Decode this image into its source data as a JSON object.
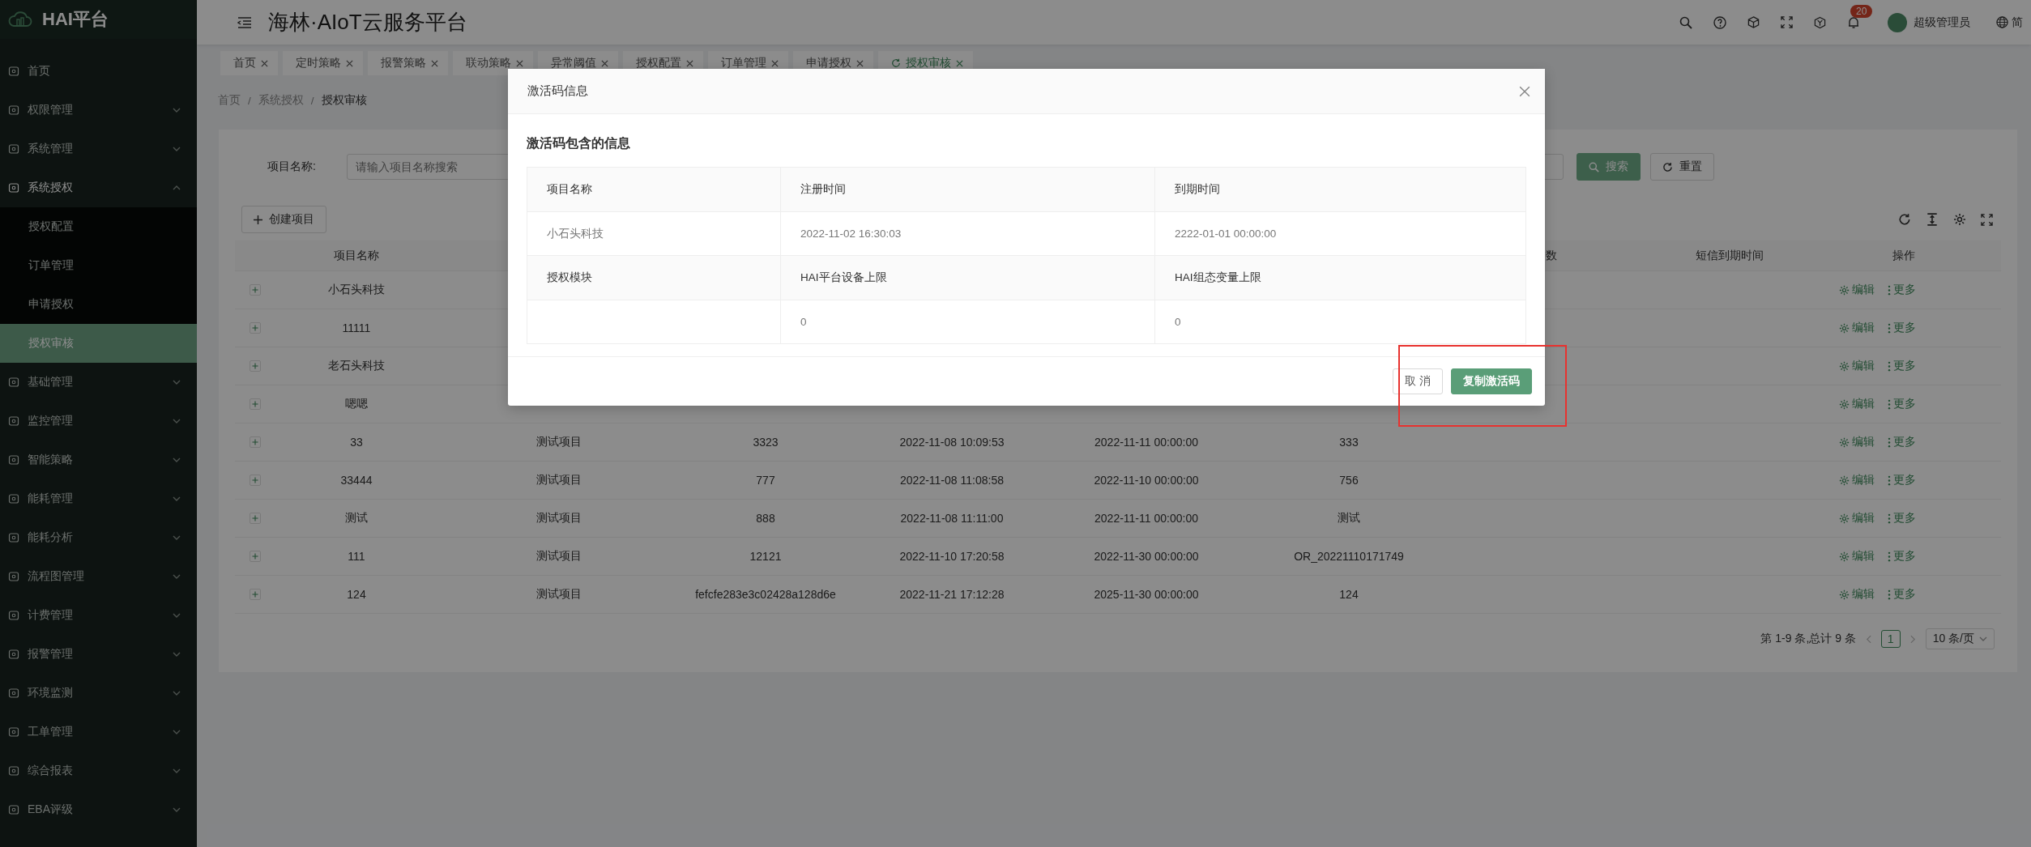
{
  "brand": {
    "name": "HAI平台"
  },
  "sidebar": {
    "items": [
      {
        "label": "首页",
        "kind": "link"
      },
      {
        "label": "权限管理",
        "kind": "group",
        "expanded": false
      },
      {
        "label": "系统管理",
        "kind": "group",
        "expanded": false
      },
      {
        "label": "系统授权",
        "kind": "group",
        "expanded": true,
        "children": [
          {
            "label": "授权配置",
            "selected": false
          },
          {
            "label": "订单管理",
            "selected": false
          },
          {
            "label": "申请授权",
            "selected": false
          },
          {
            "label": "授权审核",
            "selected": true
          }
        ]
      },
      {
        "label": "基础管理",
        "kind": "group",
        "expanded": false
      },
      {
        "label": "监控管理",
        "kind": "group",
        "expanded": false
      },
      {
        "label": "智能策略",
        "kind": "group",
        "expanded": false
      },
      {
        "label": "能耗管理",
        "kind": "group",
        "expanded": false
      },
      {
        "label": "能耗分析",
        "kind": "group",
        "expanded": false
      },
      {
        "label": "流程图管理",
        "kind": "group",
        "expanded": false
      },
      {
        "label": "计费管理",
        "kind": "group",
        "expanded": false
      },
      {
        "label": "报警管理",
        "kind": "group",
        "expanded": false
      },
      {
        "label": "环境监测",
        "kind": "group",
        "expanded": false
      },
      {
        "label": "工单管理",
        "kind": "group",
        "expanded": false
      },
      {
        "label": "综合报表",
        "kind": "group",
        "expanded": false
      },
      {
        "label": "EBA评级",
        "kind": "group",
        "expanded": false
      }
    ]
  },
  "header": {
    "title": "海林·AIoT云服务平台",
    "notifications": "20",
    "user": "超级管理员",
    "language": "简"
  },
  "tabs": [
    {
      "label": "首页",
      "selected": false
    },
    {
      "label": "定时策略",
      "selected": false
    },
    {
      "label": "报警策略",
      "selected": false
    },
    {
      "label": "联动策略",
      "selected": false
    },
    {
      "label": "异常阈值",
      "selected": false
    },
    {
      "label": "授权配置",
      "selected": false
    },
    {
      "label": "订单管理",
      "selected": false
    },
    {
      "label": "申请授权",
      "selected": false
    },
    {
      "label": "授权审核",
      "selected": true
    }
  ],
  "breadcrumb": [
    {
      "label": "首页"
    },
    {
      "separator": "/",
      "label": "系统授权"
    },
    {
      "separator": "/",
      "label": "授权审核"
    }
  ],
  "search": {
    "label": "项目名称:",
    "placeholder": "请输入项目名称搜索",
    "search_button": "搜索",
    "reset_button": "重置"
  },
  "toolbar": {
    "create_button": "创建项目"
  },
  "table": {
    "columns": [
      "",
      "项目名称",
      "",
      "",
      "",
      "",
      "",
      "数",
      "短信到期时间",
      "操作"
    ],
    "rows": [
      {
        "cells": [
          "",
          "小石头科技"
        ],
        "actions": [
          "编辑",
          "更多"
        ]
      },
      {
        "cells": [
          "",
          "11111"
        ],
        "actions": [
          "编辑",
          "更多"
        ]
      },
      {
        "cells": [
          "",
          "老石头科技"
        ],
        "actions": [
          "编辑",
          "更多"
        ]
      },
      {
        "cells": [
          "",
          "嗯嗯"
        ],
        "actions": [
          "编辑",
          "更多"
        ]
      },
      {
        "cells": [
          "",
          "33",
          "测试项目",
          "3323",
          "2022-11-08 10:09:53",
          "2022-11-11 00:00:00",
          "333"
        ],
        "actions": [
          "编辑",
          "更多"
        ]
      },
      {
        "cells": [
          "",
          "33444",
          "测试项目",
          "777",
          "2022-11-08 11:08:58",
          "2022-11-10 00:00:00",
          "756"
        ],
        "actions": [
          "编辑",
          "更多"
        ]
      },
      {
        "cells": [
          "",
          "测试",
          "测试项目",
          "888",
          "2022-11-08 11:11:00",
          "2022-11-11 00:00:00",
          "测试"
        ],
        "actions": [
          "编辑",
          "更多"
        ]
      },
      {
        "cells": [
          "",
          "111",
          "测试项目",
          "12121",
          "2022-11-10 17:20:58",
          "2022-11-30 00:00:00",
          "OR_20221110171749"
        ],
        "actions": [
          "编辑",
          "更多"
        ]
      },
      {
        "cells": [
          "",
          "124",
          "测试项目",
          "fefcfe283e3c02428a128d6e",
          "2022-11-21 17:12:28",
          "2025-11-30 00:00:00",
          "124"
        ],
        "actions": [
          "编辑",
          "更多"
        ]
      }
    ]
  },
  "pagination": {
    "summary": "第 1-9 条,总计 9 条",
    "pages": [
      {
        "label": "1",
        "selected": true
      }
    ],
    "page_size": "10 条/页"
  },
  "dialog": {
    "title": "激活码信息",
    "heading": "激活码包含的信息",
    "rows": [
      {
        "kind": "label",
        "cells": [
          "项目名称",
          "注册时间",
          "到期时间"
        ]
      },
      {
        "kind": "value",
        "cells": [
          "小石头科技",
          "2022-11-02 16:30:03",
          "2222-01-01 00:00:00"
        ]
      },
      {
        "kind": "label",
        "cells": [
          "授权模块",
          "HAI平台设备上限",
          "HAI组态变量上限"
        ]
      },
      {
        "kind": "value",
        "cells": [
          null,
          "0",
          "0"
        ]
      }
    ],
    "buttons": [
      {
        "label": "取 消",
        "kind": "default"
      },
      {
        "label": "复制激活码",
        "kind": "primary"
      }
    ]
  }
}
